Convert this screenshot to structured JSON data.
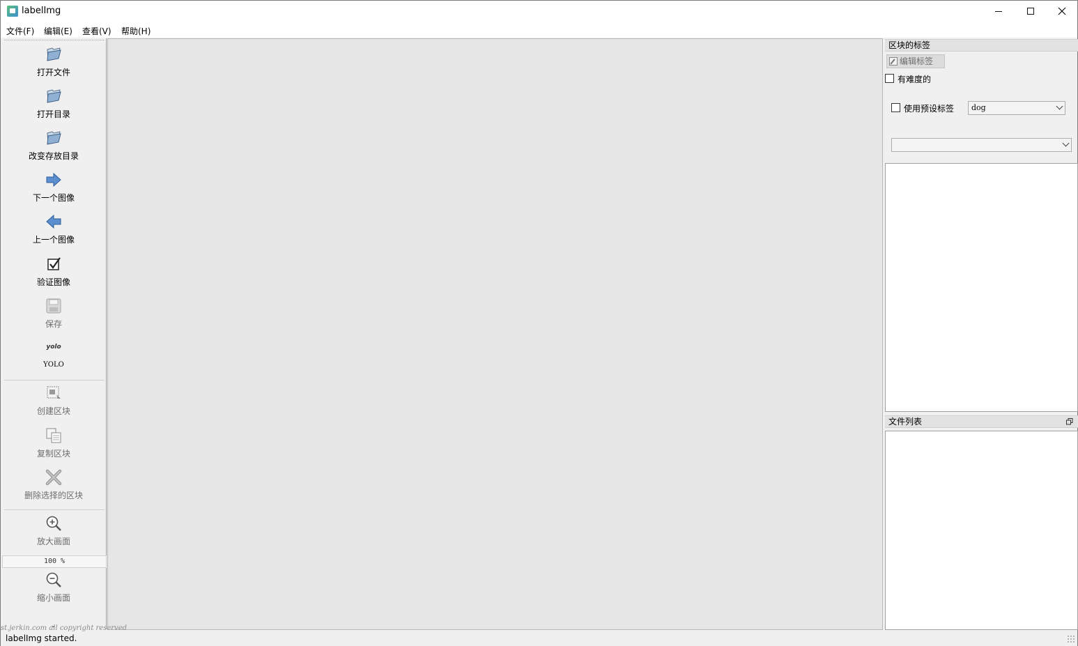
{
  "window": {
    "title": "labelImg"
  },
  "menu": {
    "file": "文件(F)",
    "edit": "编辑(E)",
    "view": "查看(V)",
    "help": "帮助(H)"
  },
  "toolbar": {
    "open_file": "打开文件",
    "open_dir": "打开目录",
    "change_save_dir": "改变存放目录",
    "next_image": "下一个图像",
    "prev_image": "上一个图像",
    "verify_image": "验证图像",
    "save": "保存",
    "yolo_icon_text": "yolo",
    "format": "YOLO",
    "create_box": "创建区块",
    "duplicate_box": "复制区块",
    "delete_box": "删除选择的区块",
    "zoom_in": "放大画面",
    "zoom_value": "100 %",
    "zoom_out": "缩小画面"
  },
  "labels_dock": {
    "title": "区块的标签",
    "edit_label": "编辑标签",
    "difficult": "有难度的",
    "use_default_label": "使用预设标签",
    "default_label_value": "dog",
    "label_filter_value": ""
  },
  "file_dock": {
    "title": "文件列表"
  },
  "status": {
    "text": "labelImg started.",
    "watermark": "st.jerkin.com all copyright reserved"
  }
}
